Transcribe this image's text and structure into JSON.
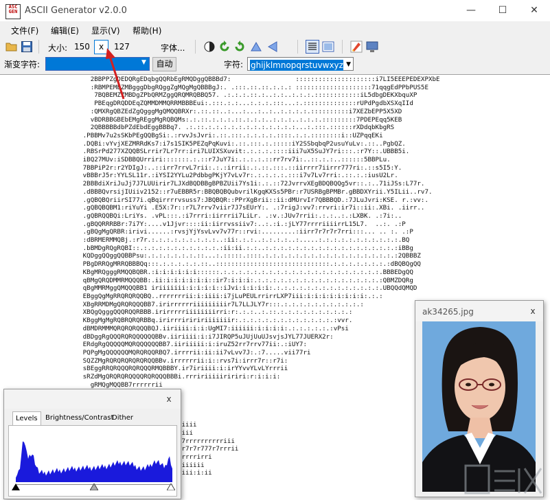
{
  "window": {
    "title": "ASCII Generator v2.0.0",
    "logo_text": "ASC\nGEN",
    "minimize": "—",
    "maximize": "☐",
    "close": "✕"
  },
  "menu": [
    "文件(F)",
    "编辑(E)",
    "显示(V)",
    "帮助(H)"
  ],
  "toolbar": {
    "size_label": "大小:",
    "width_value": "150",
    "x_button": "x",
    "height_value": "127",
    "font_button": "字体...",
    "gradient_label": "渐变字符:",
    "gradient_value": "",
    "auto_button": "自动",
    "chars_label": "字符:",
    "chars_value": "ghijklmnopqrstuvwxyz$"
  },
  "ascii_lines": [
    "                      2BBPPZgDEDQRgEDqbgQQRbEgRMQDggQBBBd7:                 :::::::::::::::::::::i7LI5EEEPEDEXPXbE",
    "                      :RBMPEMEZMBgggDbgRQggZgMQgMgQBBBgJ:. .:::.::.::.:.:.: ::::::::::::::::::::71qqgEdPPbPUS5E",
    "                       7BQBEMZZMBDgZPbQRMZggQRQMRQBBQ57. .:.:.:.::.:..:.:..:.:.:.::::::::::::iL5dbgDEKXbquXP",
    "                       PBEqgDRQDDEqZQMMDMMQRRMBBBEui:.:::.:.:...:.:.:.:::...:.::::::::::::::rUPdPgdbXSXqIId",
    "                      :QMXRgQBZEdZgQgggMgQMQQBRXr:.::.::..:...:...:..:..:.:.:.:.::::::::::i7XEZbEPP5X5XD",
    "                      vBDRBBGBEbEMgREggMgRQBQMs:.:.::.:.:.:.::.:.:.:..:.:.:..:.:.:.:::::::::7PDEPEqq5KEB",
    "                      2QBBBBBdbPZdEbdEggBBBq7. .:.::.:.:.:.:.:.:.:.:.:.:.:.:...:.:::.::::::rXDdqbKbgRS",
    "                    .PBBMv7u2sSKbPEgQQBgSi:.:rvvJsJvri:.::.:::.:.:.:.:.::::.:.:.::::::::i::UZPqqEKi",
    "                    .DQBi:vYvjXEZMRRdKs7:i7s1SIK5PEZqPqKuvi:.::.:::.:.:::::iY2SSbqbqP2usuYuLv:.::..PgbQZ.",
    "                    .RBSrPd277XZQQBSLrrir7Lr7rr:iri7LUIXSXuvit:.:.:.:.::::iii7uX5SuJY7ri:::.:r7Y::.UBBB5i.",
    "                    iBQ27MUv:iSDBBQUrriri:::::::.:.::r7JuY7i:.:.:.:.::rr7rv7i:..::.:.:..::::::5BBPLu.",
    "                    7BBPiP2r:r2YDIgJ:..::irr7rrvL7rii:.:.:irrii:.:.::.:::.::iirrrr7iirrr777ri:.::s5I5:Y.",
    "                    vBBBrJ5r:YYLSL11r.:iYSI2YYLu2PdbbgPKjY7vLv7r:.:.:.:.:.:::i7v7Lv7rri:.::.:.:iusU2Lr.",
    "                    2BBBdiXriJuJj7J7LUUirir7LJXdBQDBBgBPBZUii7Ys1i:.:.::72JvrrvXEgBDQBQQg5vr::.:..71iJSs:L77r.",
    "                    .dBBBQvrsijIUiiv2152::r7uEBBR5r:BBQBQBQubvrilKgqKXSs5PBr:r7USRBgBPMBr.gBBDXYrii.Y5ILii..rv7.",
    "                    .gQBQBQriirSI77i.qBqirrrrvsuss7:JBQBQR::PPrXgBrii::ii:dMUrvIr7QBBBQD.:7JLuJvri:KSE. r.:vv:.",
    "                    .gQBQBQBM1:riYuYi .E5X:7r::r7L7rrv7viir7J7sEUrY:. .:7rigJ:vv7:rrvri:ir7i::ii:.XBi. .iirr..",
    "                    .gQBRQQBQi:LriYs. .vPL:::.:i7rrri:iirrrii7LiLr. .:v.:JUv7rrii:.:.:..:.:LXBK. .:7i:..",
    "                    .gBQQRRRBBr:7i7Y:....v1Jjvr::::ii:iirrvssiiv7:..:.:i.:jLY77rrrriiiirrL15L7.  ..:. .:P",
    "                    .gBQgMgQRBR:irivi......:rvsjYjYsvLvv7v77r::rvi:.........:iirr7r7r7r7rri:::... .. :. .:P",
    "                    :dBRMERMMQBj.:r7r.:.:.:.:.:.:.:.:.:..:ii:.:.:..:.:.:.:..:.....:.:.:.:.:.:.:.:.:.:.:.BQ",
    "                    .bBMDgRQgRQBI::.:.:.:.:.:.:.:.:.:.:.:ii:ii.:.:..:.:.:.:.:.:.:.:.:.:.:.:.:.:.:.:.:.:iBBg",
    "                    KQDggQQggQQBBPsu:.:.:.:.:.:.:.::...:.:::::.::::.:.:.:.:.:.:.:.:.:.:.:.:.:.:.:.:.:.:2QBBBZ",
    "                    PBgDRRQgMRRQBBBQq:::.:.:.:.:.:.::..::::::::::::::::::::::::::::::.:.:.:.:.:.:.:.:dBQBQgQQ",
    "                    KBgMRQgggRMQQBQBR.:i:i:i:i:i:i::::::.:.:.:.:.:.:.:.:.:.:.:.:.:.:.:.:.:.:.:.:.:.BBBEDgQQ",
    "                    qBMgQRQDMMRMQQQBB:.ii:i:i:i:i:i:i::ir7:i:i:i:.:.:.:.:.:.:.:.:.:.:.:.:.:.:.:.:.:QBMZDQRg",
    "                    qBgMMRMggQMQQQBB1 iriiiiiii:i:i:i:i::iJvi:i:i:i:i:.:.:.:.:.:.:.:.:.:.:.:.:.:.:.UBQQdQMQD",
    "                    EBggQgMgRRQRQRQQBQ..rrrrrrrii:i:iiii:i7jLuPEULrrirrLXP7iii:i:i:i:i:i:i:i:i:.:.:",
    "                    XBgRRMDMgQRQRQQQBB7.irirrrrrriiiiiiiiir7L7LLJLY7r:::.:.:.:.:.:.:.:.:.:.:.:",
    "                    XBQgQgggQQQRQQRBBB.irirrrrriiiiiiiirri:r:.:.:..:.::.:.:.:.:.:.:.:.:.:.:",
    "                    KBggMgMgRQBRQRQRBBq.irirrririririiiiiiir:.:.:.:.:.:.:.:.:.:.:.:.:.:vvr.",
    "                    dBMDRMMMQRQRQRQQQBQJ.iiriiii:i:i:UgMI7:iiiiii:i:i:i:i:.:.:.:.:.:.:vPsi",
    "                    dBDggRgQQQRQRQQQQQQBBv.iiriiii:i:i7JIRQP5uJUjUuUJsvjsJYL77JUERX2r:",
    "                    ERdgRgQQQQQMQRQQQQQQBB7.iiriiiii:i:iruZ52rr7rrv77ii:.:iUY7:",
    "                    PQPgMgQQQQQQMQRQRQQRBQ7.irrrrii:ii:ii7vLvv7J:.:7.....vii77ri",
    "                    SQZZMgRQRQRQRQRQRQQBBv.irrrrrrii:i::rvs7i:irrr7r::r7i:",
    "                    sBEggRRQRQQQRQRQQQRMQBBBY.ir7iriiii:i:irYYvvYLvLYrrrii",
    "                    sRZdMgQRQRQRQQQQRQRQQQBBBi.rrririiiiiririri:r:i:i:i:",
    "                      gRMQgMQQBB7rrrrrrii",
    "                      QRMQRQQBBBLrrrrrrii",
    "                      QMgRMBBBMvr7rrrrrii",
    "                      MQMQQgQBQv:7rrrrrii",
    "                      ZgMQBBBs s77r7rrrrii",
    "                      RRRRQQQB.:j7rrrrr77rririiiii",
    "                      gMQBREBB .S7rrrrrr7rr7rriii",
    "                      QRMPMBB .Svrrirrrrrrrr777rrrrrrrrrriii",
    "                      QMgdDRB5  Lurirriiiririrr7r7r777r7rrrii",
    "                      DgDDgQBP  .S7riiiiiiiiiirrrrirri",
    "                      RggZgMBB   rS77iiiiiiiiiiiiiii",
    "                      dQgDqDQBB:   iI7rrriiiiiiii:i:ii"
  ],
  "levels_panel": {
    "tabs": [
      "Levels",
      "Brightness/Contrast",
      "Dither"
    ],
    "close": "x"
  },
  "image_panel": {
    "title": "ak34265.jpg",
    "close": "x"
  },
  "colors": {
    "selection": "#0078d7",
    "histogram": "#1a1adc",
    "arrow": "#d42020",
    "portrait_bg": "#6fa9dd"
  }
}
